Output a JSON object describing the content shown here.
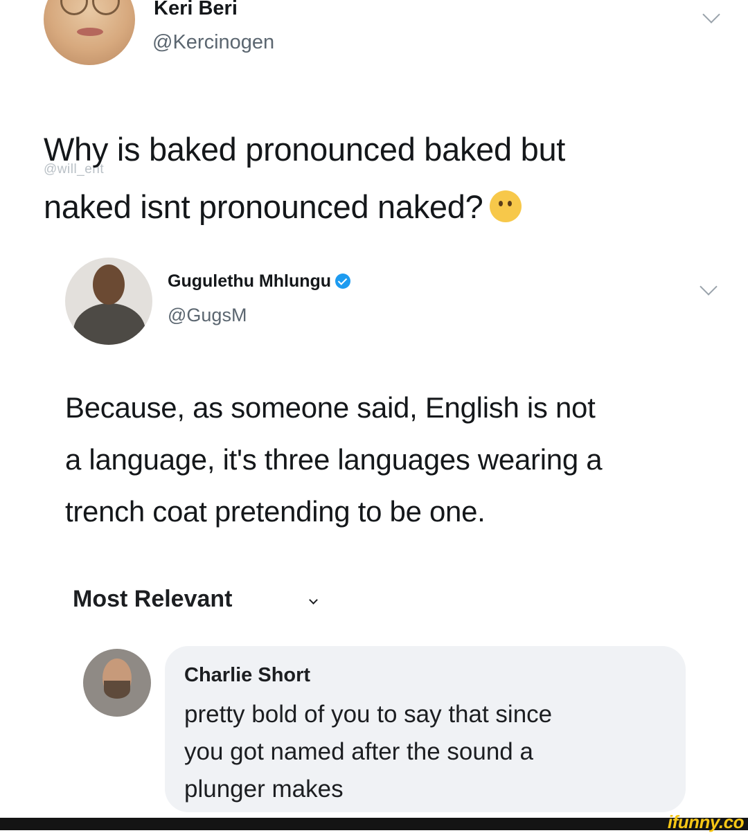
{
  "tweet1": {
    "name": "Keri Beri",
    "handle": "@Kercinogen",
    "text_line1": "Why is baked pronounced baked but",
    "text_line2": "naked isnt pronounced naked?",
    "emoji": "thinking-face-icon",
    "watermark": "@will_ent"
  },
  "tweet2": {
    "name": "Gugulethu Mhlungu",
    "handle": "@GugsM",
    "text_lines": [
      "Because, as someone said, English is not",
      "a language, it's three languages wearing a",
      "trench coat pretending to be one."
    ]
  },
  "comments": {
    "sort_label": "Most Relevant",
    "items": [
      {
        "name": "Charlie Short",
        "text_lines": [
          "pretty bold of you to say that since",
          "you got named after the sound a",
          "plunger makes"
        ]
      }
    ]
  },
  "footer": {
    "brand": "ifunny.co"
  },
  "colors": {
    "verified": "#1d9bf0",
    "brand": "#f6c615",
    "bubble": "#f0f2f5"
  }
}
